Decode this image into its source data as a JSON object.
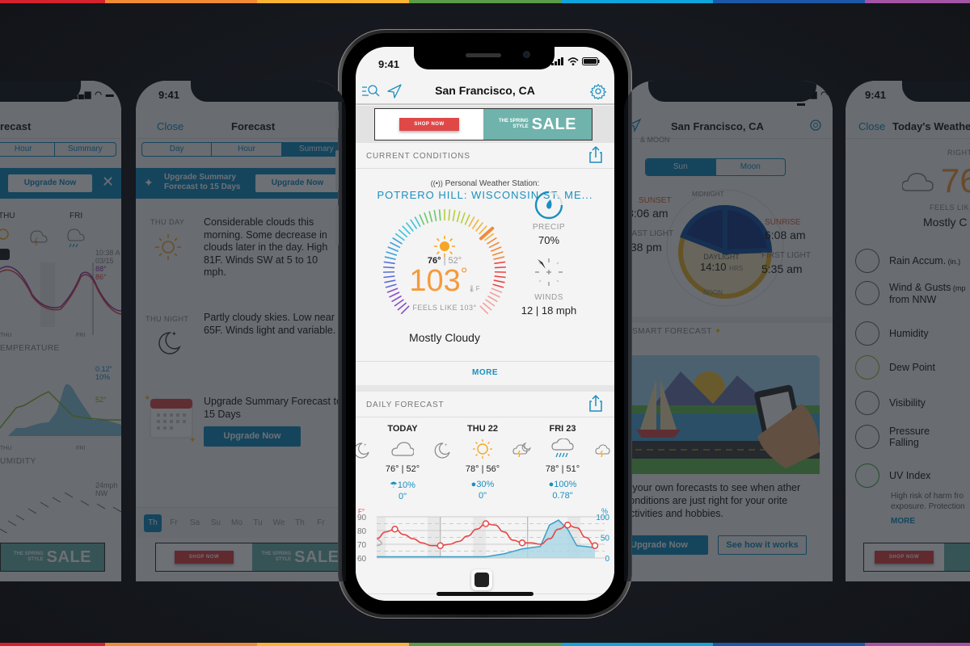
{
  "stripe_colors": [
    "#d4232f",
    "#f08a35",
    "#fbb431",
    "#5a9c47",
    "#0ea5dc",
    "#1c58a7",
    "#a354a4"
  ],
  "brand": {
    "accent": "#1a8fbf",
    "temp_orange": "#f59a3a",
    "temp_line": "#e84545",
    "precip_fill": "#a9d6e5"
  },
  "ad": {
    "shop_label": "SHOP NOW",
    "tag_small_1": "THE SPRING",
    "tag_small_2": "STYLE",
    "tag_big": "SALE"
  },
  "left_panel_1": {
    "title": "recast",
    "tabs": [
      "Hour",
      "Summary"
    ],
    "upgrade_button": "Upgrade Now",
    "close_icon": "close-icon",
    "days": [
      "THU",
      "FRI"
    ],
    "timestamp": "10:38 A",
    "date": "03/15",
    "temp_high_purple": "88°",
    "temp_high_red": "86°",
    "section_temperature": "EMPERATURE",
    "axis_labels": [
      "THU",
      "FRI"
    ],
    "precip_amount": "0.12\"",
    "precip_percent": "10%",
    "dewpoint": "52°",
    "section_humidity": "UMIDITY",
    "wind_speed": "24mph",
    "wind_dir": "NW"
  },
  "left_panel_2": {
    "time": "9:41",
    "close": "Close",
    "title": "Forecast",
    "tabs": [
      "Day",
      "Hour",
      "Summary"
    ],
    "upgrade_banner_line1": "Upgrade Summary",
    "upgrade_banner_line2": "Forecast to 15 Days",
    "upgrade_banner_button": "Upgrade Now",
    "entries": [
      {
        "label": "THU DAY",
        "text": "Considerable clouds this morning. Some decrease in clouds later in the day. High 81F. Winds SW at 5 to 10 mph."
      },
      {
        "label": "THU NIGHT",
        "text": "Partly cloudy skies. Low near 65F. Winds light and variable."
      }
    ],
    "promo_text": "Upgrade Summary Forecast to 15 Days",
    "promo_button": "Upgrade Now",
    "day_tabs": [
      "Th",
      "Fr",
      "Sa",
      "Su",
      "Mo",
      "Tu",
      "We",
      "Th",
      "Fr"
    ]
  },
  "center_phone": {
    "status_time": "9:41",
    "location": "San Francisco, CA",
    "current_conditions": {
      "header": "CURRENT CONDITIONS",
      "station_label": "Personal Weather Station:",
      "station_name": "POTRERO HILL: WISCONSIN ST. ME...",
      "high": "76°",
      "low": "52°",
      "temperature": "103",
      "degree": "°",
      "unit": "F",
      "feels_like": "FEELS LIKE 103°",
      "condition": "Mostly Cloudy",
      "precip_label": "PRECIP",
      "precip_value": "70%",
      "winds_label": "WINDS",
      "winds_value": "12 | 18 mph",
      "more": "MORE"
    },
    "daily_forecast": {
      "header": "DAILY FORECAST",
      "days": [
        {
          "name": "TODAY",
          "icon": "cloud-icon",
          "hilo": "76° | 52°",
          "precip": "10%",
          "amount": "0\""
        },
        {
          "name": "THU 22",
          "icon": "sun-icon",
          "hilo": "78° | 56°",
          "precip": "30%",
          "amount": "0\""
        },
        {
          "name": "FRI 23",
          "icon": "rain-icon",
          "hilo": "78° | 51°",
          "precip": "100%",
          "amount": "0.78\""
        }
      ]
    }
  },
  "chart_data": {
    "type": "line",
    "title": "",
    "left_axis_unit": "F°",
    "right_axis_unit": "%",
    "yticks_left": [
      "90",
      "80",
      "70",
      "60"
    ],
    "yticks_right": [
      "100",
      "50",
      "0"
    ],
    "ylim_left": [
      60,
      90
    ],
    "ylim_right": [
      0,
      100
    ],
    "series": [
      {
        "name": "temperature",
        "color": "#e84545",
        "x": [
          0,
          0.5,
          1,
          1.5,
          2,
          2.5,
          3,
          3.5,
          4,
          4.5,
          5,
          5.5,
          6,
          6.5,
          7,
          7.5,
          8,
          8.5,
          9,
          9.5,
          10,
          10.5,
          11,
          11.5,
          12
        ],
        "values": [
          74,
          79,
          81,
          77,
          74,
          71,
          69,
          69,
          70,
          72,
          76,
          81,
          85,
          84,
          79,
          73,
          71,
          71,
          70,
          74,
          81,
          84,
          82,
          75,
          69
        ]
      },
      {
        "name": "precip_chance",
        "color": "#3a9fc7",
        "x": [
          0,
          1,
          2,
          3,
          4,
          5,
          6,
          7,
          8,
          9,
          9.5,
          10,
          10.5,
          11,
          11.5,
          12
        ],
        "values": [
          3,
          3,
          3,
          3,
          3,
          3,
          3,
          10,
          22,
          28,
          80,
          92,
          70,
          30,
          28,
          25
        ]
      }
    ],
    "markers_temperature": [
      [
        1,
        81
      ],
      [
        3.5,
        69
      ],
      [
        6,
        85
      ],
      [
        8,
        71
      ],
      [
        10.5,
        84
      ],
      [
        12,
        69
      ]
    ],
    "moon_badge_icon": "moon-icon"
  },
  "right_panel_1": {
    "title": "San Francisco, CA",
    "section": "& MOON",
    "tabs": [
      "Sun",
      "Moon"
    ],
    "midnight": "MIDNIGHT",
    "noon": "NOON",
    "sunset_label": "SUNSET",
    "sunset_time": "8:06 am",
    "last_light_label": "LAST LIGHT",
    "last_light_time": ":38 pm",
    "sunrise_label": "SUNRISE",
    "sunrise_time": "6:08 am",
    "first_light_label": "FIRST LIGHT",
    "first_light_time": "5:35 am",
    "daylight_label": "DAYLIGHT",
    "daylight_value": "14:10",
    "daylight_unit": "HRS",
    "smart_forecast": "SMART FORECAST",
    "smart_text": "d your own forecasts to see when ather conditions are just right for your orite activities and hobbies.",
    "upgrade_button": "Upgrade Now",
    "how_button": "See how it works"
  },
  "right_panel_2": {
    "time": "9:41",
    "close": "Close",
    "title": "Today's Weathe",
    "right_now": "RIGHT N",
    "temp": "76",
    "feels": "FEELS LIK",
    "cond": "Mostly C",
    "items": [
      {
        "label": "Rain Accum.",
        "sub": "(in.)",
        "icon": "rain-gauge-icon"
      },
      {
        "label": "Wind & Gusts",
        "sub": "(mp",
        "line2": "from NNW",
        "icon": "wind-compass-icon"
      },
      {
        "label": "Humidity",
        "icon": "humidity-icon"
      },
      {
        "label": "Dew Point",
        "icon": "dew-point-icon"
      },
      {
        "label": "Visibility",
        "icon": "eye-icon"
      },
      {
        "label": "Pressure",
        "line2": "Falling",
        "icon": "pressure-arrow-icon"
      },
      {
        "label": "UV Index",
        "icon": "uv-icon"
      }
    ],
    "uv_desc_1": "High risk of harm fro",
    "uv_desc_2": "exposure. Protection",
    "more": "MORE"
  }
}
